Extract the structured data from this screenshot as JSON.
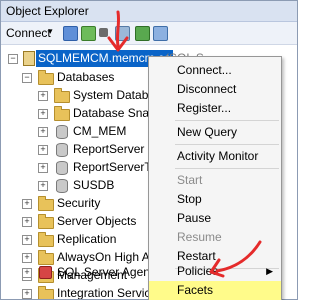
{
  "window": {
    "title": "Object Explorer"
  },
  "toolbar": {
    "connect_label": "Connect",
    "connect_caret": "▾"
  },
  "tree": {
    "server": "SQLMEMCM.memcm.co",
    "server_suffix": "(SQL S...",
    "databases": "Databases",
    "system_databases": "System Database",
    "snapshots": "Database Snapsh",
    "db1": "CM_MEM",
    "db2": "ReportServer",
    "db3": "ReportServerTem",
    "db4": "SUSDB",
    "security": "Security",
    "server_objects": "Server Objects",
    "replication": "Replication",
    "alwayson": "AlwaysOn High Avai",
    "management": "Management",
    "integration": "Integration Services C",
    "agent": "SQL Server Agent"
  },
  "context_menu": {
    "connect": "Connect...",
    "disconnect": "Disconnect",
    "register": "Register...",
    "new_query": "New Query",
    "activity_monitor": "Activity Monitor",
    "start": "Start",
    "stop": "Stop",
    "pause": "Pause",
    "resume": "Resume",
    "restart": "Restart",
    "policies": "Policies",
    "facets": "Facets",
    "submenu_arrow": "▶"
  },
  "colors": {
    "accent": "#0a64c8",
    "annotation": "#e52b2b",
    "highlight": "#fffb8a"
  }
}
